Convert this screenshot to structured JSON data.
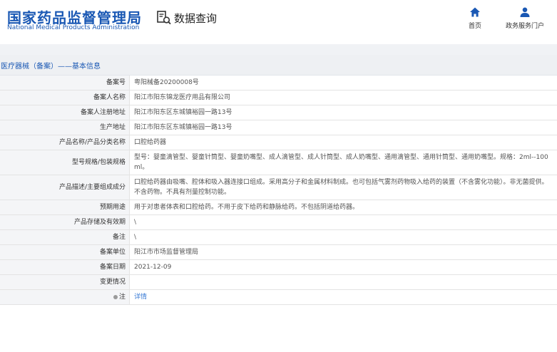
{
  "header": {
    "logo_cn": "国家药品监督管理局",
    "logo_en": "National Medical Products Administration",
    "module_title": "数据查询",
    "nav": [
      {
        "label": "首页",
        "icon": "home-icon"
      },
      {
        "label": "政务服务门户",
        "icon": "user-icon"
      }
    ]
  },
  "section": {
    "title": "医疗器械（备案）——基本信息"
  },
  "rows": [
    {
      "label": "备案号",
      "value": "粤阳械备20200008号"
    },
    {
      "label": "备案人名称",
      "value": "阳江市阳东锦龙医疗用品有限公司"
    },
    {
      "label": "备案人注册地址",
      "value": "阳江市阳东区东城镇裕园一路13号"
    },
    {
      "label": "生产地址",
      "value": "阳江市阳东区东城镇裕园一路13号"
    },
    {
      "label": "产品名称/产品分类名称",
      "value": "口腔给药器"
    },
    {
      "label": "型号规格/包装规格",
      "value": "型号：婴童滴管型、婴童针筒型、婴童奶嘴型、成人滴管型、成人针筒型、成人奶嘴型、通用滴管型、通用针筒型、通用奶嘴型。规格：2ml--100ml。"
    },
    {
      "label": "产品描述/主要组成成分",
      "value": "口腔给药器由吸嘴、腔体和吸入器连接口组成。采用高分子和金属材料制成。也可包括气雾剂药物吸入给药的装置（不含雾化功能）。非无菌提供。不含药物。不具有剂量控制功能。"
    },
    {
      "label": "预期用途",
      "value": "用于对患者体表和口腔给药。不用于皮下给药和静脉给药。不包括阴道给药器。"
    },
    {
      "label": "产品存储及有效期",
      "value": "\\"
    },
    {
      "label": "备注",
      "value": "\\"
    },
    {
      "label": "备案单位",
      "value": "阳江市市场监督管理局"
    },
    {
      "label": "备案日期",
      "value": "2021-12-09"
    },
    {
      "label": "变更情况",
      "value": ""
    }
  ],
  "note_row": {
    "label": "注",
    "link": "详情",
    "icon": "pin-icon"
  },
  "colors": {
    "brand": "#1a58b4",
    "link": "#3a7bd5"
  }
}
